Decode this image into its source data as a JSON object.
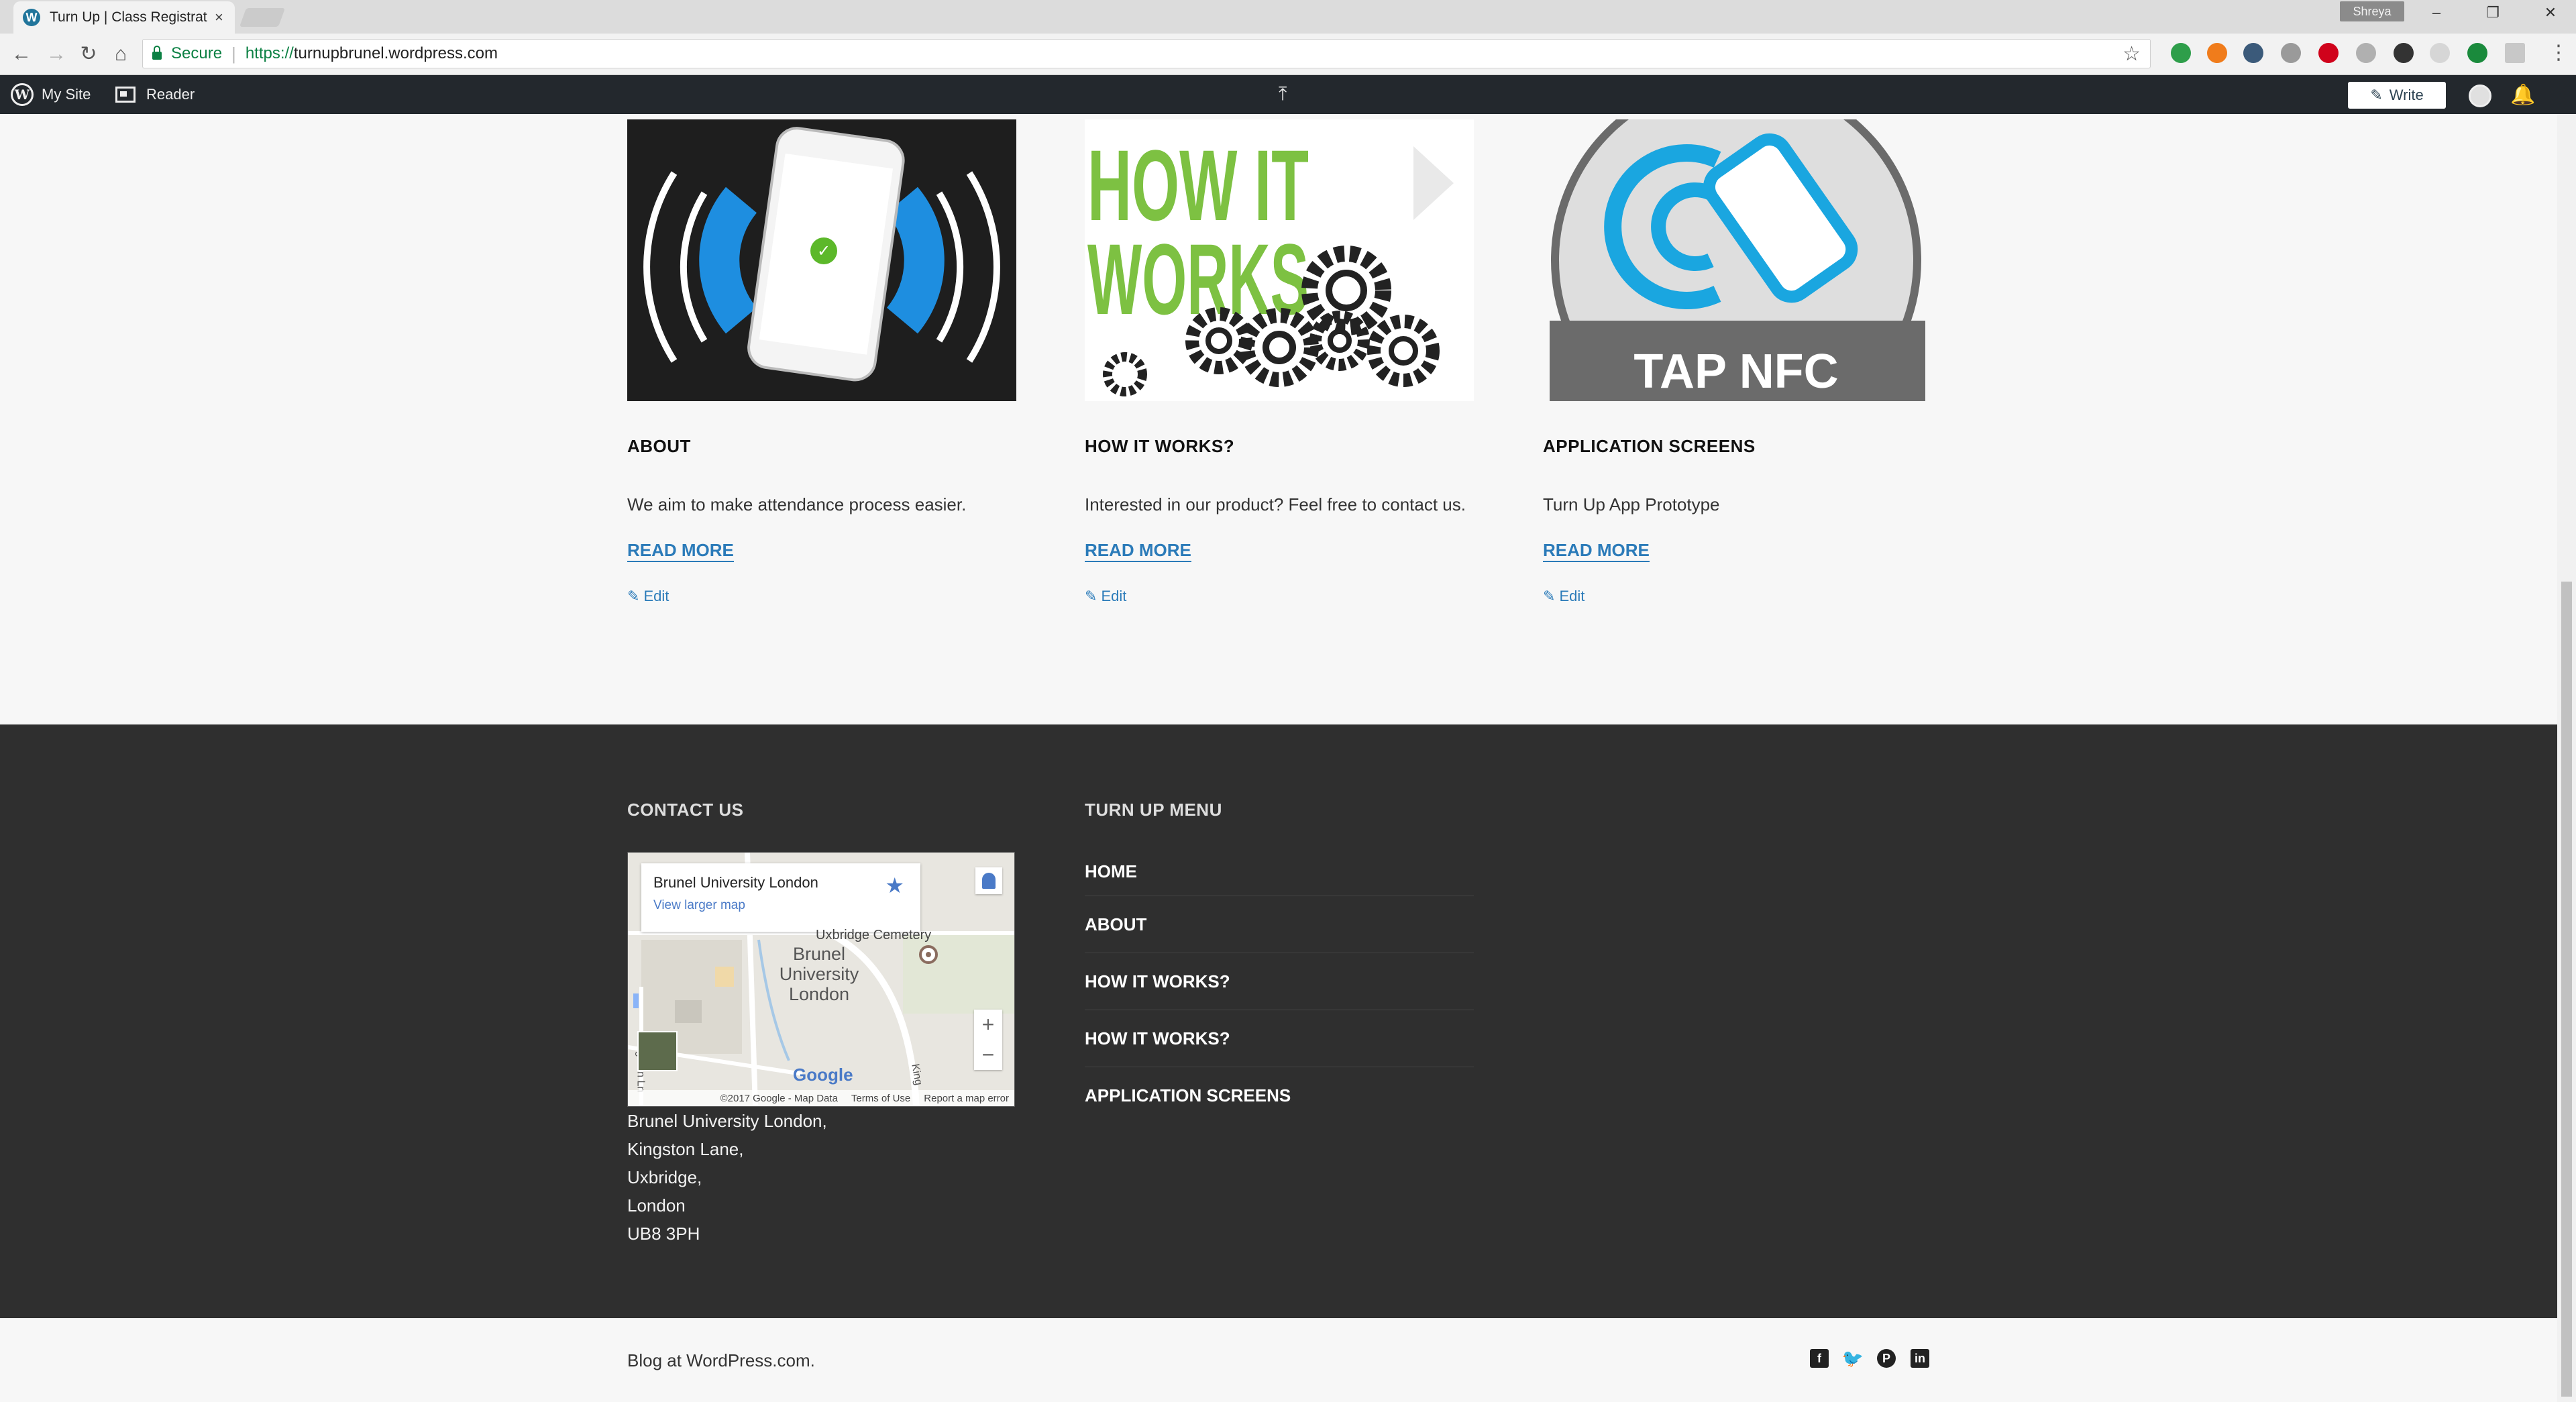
{
  "browser": {
    "tab_title": "Turn Up | Class Registrat",
    "tab_close": "×",
    "profile_name": "Shreya",
    "minimize": "–",
    "restore": "❐",
    "close": "✕",
    "secure_label": "Secure",
    "url_scheme": "https://",
    "url_host": "turnupbrunel.wordpress.com"
  },
  "adminbar": {
    "my_site": "My Site",
    "reader": "Reader",
    "write": "Write"
  },
  "cards": [
    {
      "title": "ABOUT",
      "text": "We aim to make attendance process easier.",
      "read_more": "READ MORE",
      "edit": "Edit"
    },
    {
      "title": "HOW IT WORKS?",
      "text": "Interested in our product? Feel free to contact us.",
      "read_more": "READ MORE",
      "edit": "Edit",
      "image_text_1": "HOW IT",
      "image_text_2": "WORKS"
    },
    {
      "title": "APPLICATION SCREENS",
      "text": "Turn Up App Prototype",
      "read_more": "READ MORE",
      "edit": "Edit",
      "image_text": "TAP NFC"
    }
  ],
  "footer": {
    "contact_heading": "CONTACT US",
    "menu_heading": "TURN UP MENU",
    "map": {
      "place_name": "Brunel University London",
      "larger_map": "View larger map",
      "label_cemetery": "Uxbridge Cemetery",
      "label_campus_1": "Brunel",
      "label_campus_2": "University",
      "label_campus_3": "London",
      "label_road_1": "Kingston Ln",
      "label_road_2": "King",
      "zoom_in": "+",
      "zoom_out": "−",
      "google": "Google",
      "attr_data": "©2017 Google - Map Data",
      "attr_terms": "Terms of Use",
      "attr_report": "Report a map error"
    },
    "address": [
      "Brunel University London,",
      "Kingston Lane,",
      "Uxbridge,",
      "London",
      "UB8 3PH"
    ],
    "menu_items": [
      "HOME",
      "ABOUT",
      "HOW IT WORKS?",
      "HOW IT WORKS?",
      "APPLICATION SCREENS"
    ]
  },
  "credit": "Blog at WordPress.com.",
  "social": [
    "facebook-icon",
    "twitter-icon",
    "pinterest-icon",
    "linkedin-icon"
  ],
  "colors": {
    "link": "#2b7bb9",
    "footer_bg": "#2f2f2f",
    "adminbar_bg": "#23282d",
    "nfc_blue": "#1aa6e0",
    "howitworks_green": "#7dc142"
  }
}
